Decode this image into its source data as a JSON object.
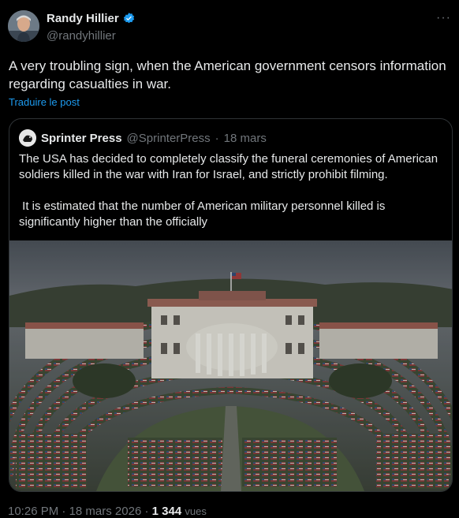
{
  "author": {
    "name": "Randy Hillier",
    "handle": "@randyhillier",
    "verified_icon": "verified-badge-icon"
  },
  "more_icon": "more-options-icon",
  "tweet": {
    "text": "A very troubling sign, when the American government censors information regarding casualties in war.",
    "translate_label": "Traduire le post"
  },
  "quote": {
    "name": "Sprinter Press",
    "handle": "@SprinterPress",
    "separator": "·",
    "date": "18 mars",
    "paragraph1": "The USA has decided to completely classify the funeral ceremonies of American soldiers killed in the war with Iran for Israel, and strictly prohibit filming.",
    "paragraph2": " It is estimated that the number of American military personnel killed is significantly higher than the officially",
    "image_icon": "white-house-coffins-image"
  },
  "meta": {
    "time": "10:26 PM",
    "separator": "·",
    "date": "18 mars 2026",
    "views_count": "1 344",
    "views_label": "vues"
  },
  "colors": {
    "background": "#000000",
    "text": "#e7e9ea",
    "muted": "#71767b",
    "link": "#1d9bf0",
    "border": "#2f3336"
  }
}
